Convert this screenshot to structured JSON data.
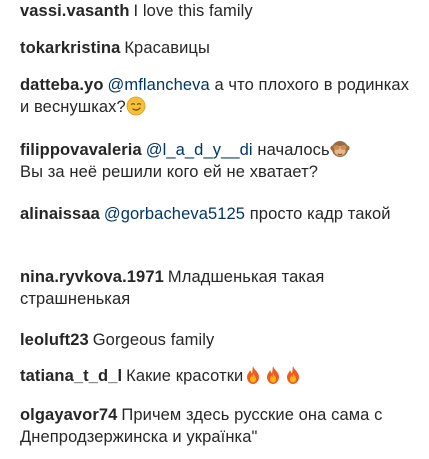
{
  "comments": [
    {
      "username": "vassi.vasanth",
      "text": "I love this family"
    },
    {
      "username": "tokarkristina",
      "text": "Красавицы"
    },
    {
      "username": "datteba.yo",
      "mention": "@mflancheva",
      "text": "а что плохого в родинках и веснушках?",
      "emoji": "smirk-face"
    },
    {
      "username": "filippovavaleria",
      "mention": "@l_a_d_y__di",
      "text": "началось",
      "emoji": "see-no-evil-monkey",
      "text2": "Вы за неё решили кого ей не хватает?"
    },
    {
      "username": "alinaissaa",
      "mention": "@gorbacheva5125",
      "text": "просто кадр такой"
    },
    {
      "username": "nina.ryvkova.1971",
      "text": "Младшенькая такая страшненькая"
    },
    {
      "username": "leoluft23",
      "text": "Gorgeous family"
    },
    {
      "username": "tatiana_t_d_l",
      "text": "Какие красотки",
      "emoji": "fire x3"
    },
    {
      "username": "olgayavor74",
      "text": "Причем здесь русские она сама с Днепродзержинска и українка\""
    }
  ],
  "colors": {
    "text": "#262626",
    "mention": "#003569"
  }
}
